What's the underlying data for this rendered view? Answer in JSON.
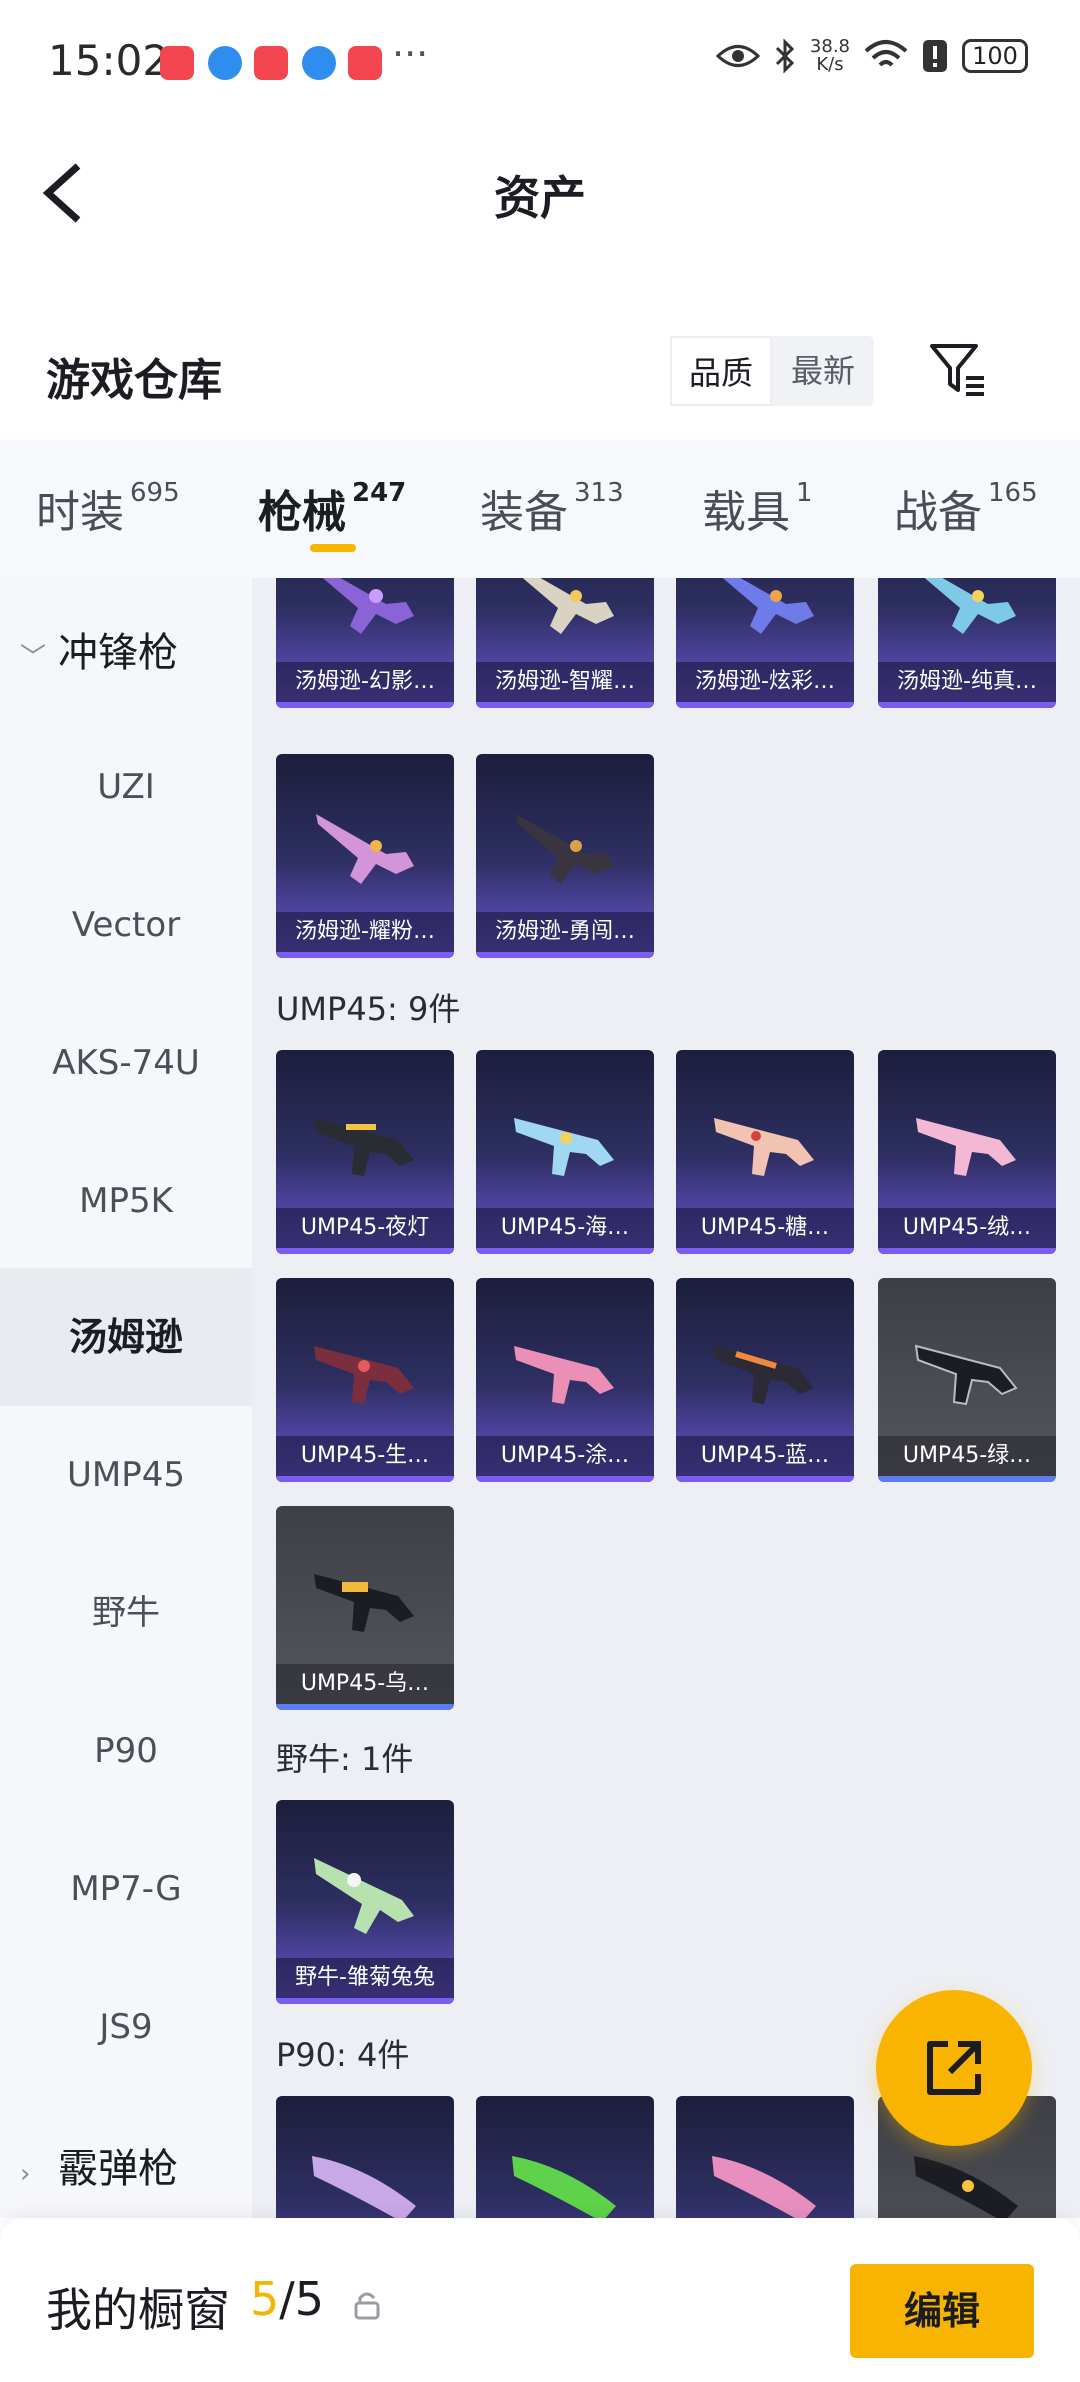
{
  "status": {
    "time": "15:02",
    "more": "···",
    "speed_top": "38.8",
    "speed_bottom": "K/s",
    "battery": "100"
  },
  "nav": {
    "title": "资产"
  },
  "section": {
    "title": "游戏仓库",
    "sort_quality": "品质",
    "sort_latest": "最新"
  },
  "tabs": [
    {
      "label": "时装",
      "count": "695"
    },
    {
      "label": "枪械",
      "count": "247"
    },
    {
      "label": "装备",
      "count": "313"
    },
    {
      "label": "载具",
      "count": "1"
    },
    {
      "label": "战备",
      "count": "165"
    }
  ],
  "sidebar": {
    "group_smg": "冲锋枪",
    "items": [
      "UZI",
      "Vector",
      "AKS-74U",
      "MP5K",
      "汤姆逊",
      "UMP45",
      "野牛",
      "P90",
      "MP7-G",
      "JS9"
    ],
    "group_shotgun": "霰弹枪"
  },
  "content": {
    "thompson_cards": [
      "汤姆逊-幻影…",
      "汤姆逊-智耀…",
      "汤姆逊-炫彩…",
      "汤姆逊-纯真…",
      "汤姆逊-耀粉…",
      "汤姆逊-勇闯…"
    ],
    "ump_title": "UMP45: 9件",
    "ump_cards": [
      "UMP45-夜灯",
      "UMP45-海…",
      "UMP45-糖…",
      "UMP45-绒…",
      "UMP45-生…",
      "UMP45-涂…",
      "UMP45-蓝…",
      "UMP45-绿…",
      "UMP45-乌…"
    ],
    "bison_title": "野牛: 1件",
    "bison_cards": [
      "野牛-雏菊兔兔"
    ],
    "p90_title": "P90: 4件"
  },
  "bottom": {
    "title": "我的橱窗",
    "count_current": "5",
    "count_total": "/5",
    "edit": "编辑"
  },
  "colors": {
    "accent": "#f8b400",
    "card_purple": "#4a3f9e",
    "card_gray": "#55565e"
  }
}
